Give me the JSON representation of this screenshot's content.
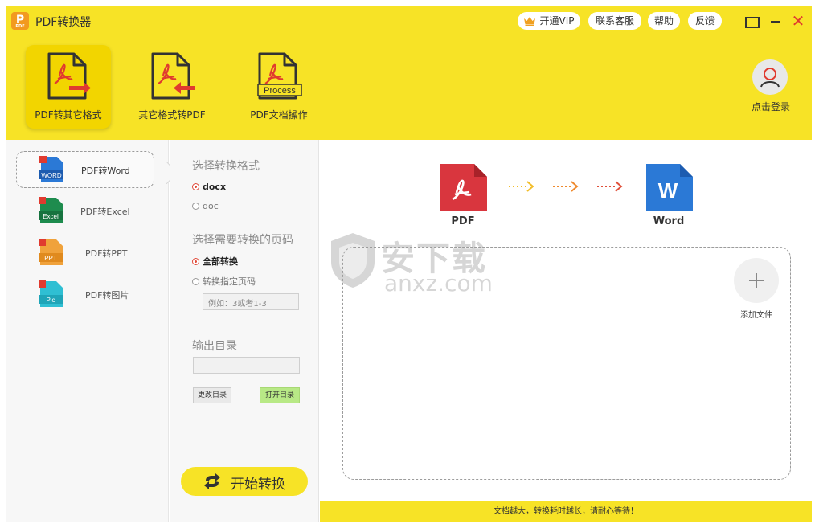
{
  "app": {
    "title": "PDF转换器",
    "logo_letter": "P",
    "logo_sub": "PDF"
  },
  "header": {
    "vip": "开通VIP",
    "service": "联系客服",
    "help": "帮助",
    "feedback": "反馈"
  },
  "toolbar": {
    "tools": [
      {
        "label": "PDF转其它格式",
        "active": true
      },
      {
        "label": "其它格式转PDF",
        "active": false
      },
      {
        "label": "PDF文档操作",
        "active": false,
        "icon_text": "Process"
      }
    ],
    "login": "点击登录"
  },
  "formats": [
    {
      "label": "PDF转Word",
      "icon_text": "WORD",
      "color": "#2b79d6",
      "selected": true
    },
    {
      "label": "PDF转Excel",
      "icon_text": "Excel",
      "color": "#1e8c4e",
      "selected": false
    },
    {
      "label": "PDF转PPT",
      "icon_text": "PPT",
      "color": "#f0a23b",
      "selected": false
    },
    {
      "label": "PDF转图片",
      "icon_text": "Pic",
      "color": "#2fbfd3",
      "selected": false
    }
  ],
  "options": {
    "format_title": "选择转换格式",
    "format_options": [
      {
        "label": "docx",
        "checked": true
      },
      {
        "label": "doc",
        "checked": false
      }
    ],
    "pages_title": "选择需要转换的页码",
    "page_options": [
      {
        "label": "全部转换",
        "checked": true
      },
      {
        "label": "转换指定页码",
        "checked": false
      }
    ],
    "page_placeholder": "例如：3或者1-3",
    "output_title": "输出目录",
    "output_value": "",
    "change_dir": "更改目录",
    "open_dir": "打开目录",
    "start": "开始转换"
  },
  "main": {
    "from_label": "PDF",
    "to_label": "Word",
    "to_icon_letter": "W",
    "add_file": "添加文件",
    "status": "文档越大，转换耗时越长，请耐心等待！",
    "watermark": {
      "text": "安下载",
      "sub": "anxz.com"
    }
  },
  "colors": {
    "brand_yellow": "#f7e326",
    "pdf_red": "#d9363e",
    "word_blue": "#2b79d6",
    "close_red": "#e03a2f"
  }
}
